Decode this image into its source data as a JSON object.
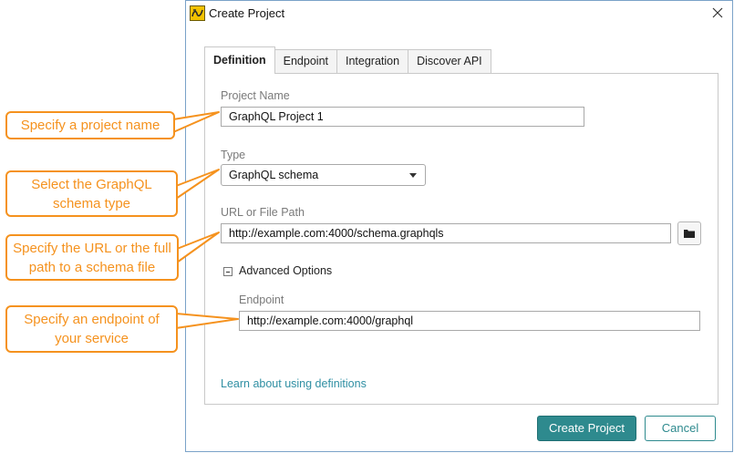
{
  "dialog": {
    "title": "Create Project",
    "app_icon": "readyapi-logo-icon",
    "close_icon": "close-icon"
  },
  "tabs": [
    {
      "label": "Definition",
      "active": true
    },
    {
      "label": "Endpoint",
      "active": false
    },
    {
      "label": "Integration",
      "active": false
    },
    {
      "label": "Discover API",
      "active": false
    }
  ],
  "form": {
    "project_name_label": "Project Name",
    "project_name_value": "GraphQL Project 1",
    "type_label": "Type",
    "type_value": "GraphQL schema",
    "url_label": "URL or File Path",
    "url_value": "http://example.com:4000/schema.graphqls",
    "browse_icon": "folder-icon",
    "advanced_toggle_icon": "collapse-minus-icon",
    "advanced_label": "Advanced Options",
    "endpoint_label": "Endpoint",
    "endpoint_value": "http://example.com:4000/graphql",
    "learn_link": "Learn about using definitions"
  },
  "buttons": {
    "create_label": "Create Project",
    "cancel_label": "Cancel"
  },
  "callouts": [
    "Specify a project name",
    "Select the GraphQL schema type",
    "Specify the URL or the full path to a schema file",
    "Specify an endpoint of your service"
  ],
  "colors": {
    "callout": "#f5921e",
    "primary": "#2e8a8e",
    "link": "#2f8fa3",
    "dialog_border": "#7aa2c8"
  }
}
